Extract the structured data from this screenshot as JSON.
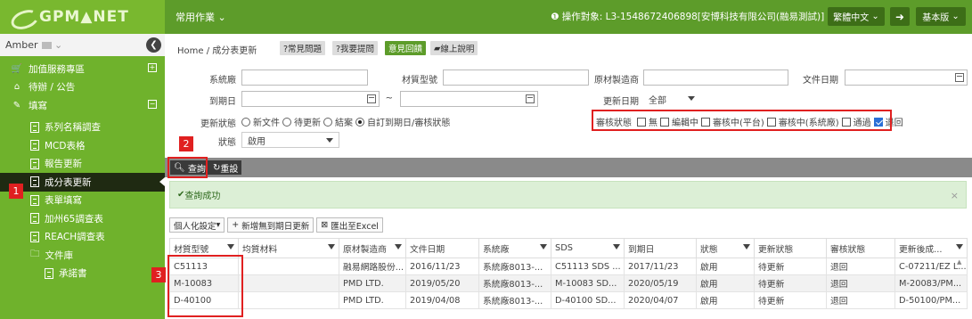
{
  "header": {
    "logo_text": "GPM▲NET",
    "top_menu": "常用作業",
    "operator_label": "操作對象: L3-1548672406898[安博科技有限公司(融易測試)]",
    "language": "繁體中文",
    "exit_icon": "exit-icon",
    "version": "基本版"
  },
  "sidebar": {
    "user": "Amber",
    "items": [
      {
        "label": "加值服務專區",
        "icon": "cart-icon",
        "level": 1
      },
      {
        "label": "待辦 / 公告",
        "icon": "home-icon",
        "level": 1
      },
      {
        "label": "填寫",
        "icon": "edit-icon",
        "level": 1
      },
      {
        "label": "系列名稱調查",
        "level": 2
      },
      {
        "label": "MCD表格",
        "level": 2
      },
      {
        "label": "報告更新",
        "level": 2
      },
      {
        "label": "成分表更新",
        "level": 2,
        "active": true
      },
      {
        "label": "表單填寫",
        "level": 2
      },
      {
        "label": "加州65調查表",
        "level": 2
      },
      {
        "label": "REACH調查表",
        "level": 2
      },
      {
        "label": "文件庫",
        "level": 2
      },
      {
        "label": "承諾書",
        "level": 3
      }
    ]
  },
  "markers": [
    "1",
    "2",
    "3"
  ],
  "breadcrumb": {
    "home": "Home",
    "sep": "/",
    "current": "成分表更新",
    "faq": "?常見問題",
    "ask": "?我要提問",
    "feedback": "意見回饋",
    "manual": "線上說明"
  },
  "filters": {
    "factory_label": "系統廠",
    "material_label": "材質型號",
    "manufacturer_label": "原材製造商",
    "docdate_label": "文件日期",
    "expiry_label": "到期日",
    "tilde": "~",
    "update_date_label": "更新日期",
    "update_date_value": "全部",
    "update_status_label": "更新狀態",
    "update_status_options": [
      "新文件",
      "待更新",
      "結案",
      "自訂到期日/審核狀態"
    ],
    "review_label": "審核狀態",
    "review_options": [
      {
        "label": "無",
        "checked": false
      },
      {
        "label": "編輯中",
        "checked": false
      },
      {
        "label": "審核中(平台)",
        "checked": false
      },
      {
        "label": "審核中(系統廠)",
        "checked": false
      },
      {
        "label": "通過",
        "checked": false
      },
      {
        "label": "退回",
        "checked": true
      }
    ],
    "state_label": "狀態",
    "state_value": "啟用"
  },
  "actions": {
    "query": "查詢",
    "reset": "重設"
  },
  "message": {
    "success": "查詢成功",
    "close": "×"
  },
  "grid_tools": {
    "personalize": "個人化設定",
    "add_new": "新增無到期日更新",
    "export": "匯出至Excel"
  },
  "table": {
    "headers": [
      "材質型號",
      "均質材料",
      "原材製造商",
      "文件日期",
      "系統廠",
      "SDS",
      "到期日",
      "狀態",
      "更新狀態",
      "審核狀態",
      "更新後成..."
    ],
    "rows": [
      [
        "C51113",
        "",
        "融易網路股份...",
        "2016/11/23",
        "系統廠8013-...",
        "C51113 SDS ...",
        "2017/11/23",
        "啟用",
        "待更新",
        "退回",
        "C-07211/EZ L..."
      ],
      [
        "M-10083",
        "",
        "PMD LTD.",
        "2019/05/20",
        "系統廠8013-...",
        "M-10083 SD...",
        "2020/05/19",
        "啟用",
        "待更新",
        "退回",
        "M-20083/PM..."
      ],
      [
        "D-40100",
        "",
        "PMD LTD.",
        "2019/04/08",
        "系統廠8013-...",
        "D-40100 SD...",
        "2020/04/07",
        "啟用",
        "待更新",
        "退回",
        "D-50100/PM..."
      ]
    ]
  },
  "colors": {
    "brand": "#6fb22c",
    "topbar": "#5d9c2a",
    "marker": "#e02020",
    "link": "#2a5fb3"
  }
}
